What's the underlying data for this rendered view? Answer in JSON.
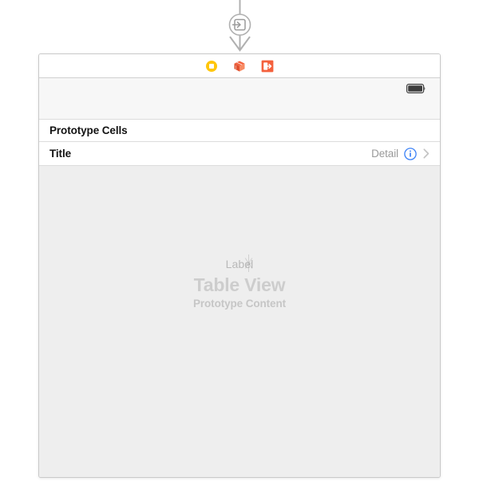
{
  "canvas": {
    "background": "#ffffff",
    "scene_border_color": "#c9c9c9"
  },
  "segue": {
    "name": "relationship-segue-connector",
    "icon": "storyboard-entry-point-icon",
    "line_color": "#b0b0b0",
    "arrow_direction": "down"
  },
  "scene": {
    "dock": {
      "items": [
        {
          "icon": "view-controller-icon",
          "label": "View Controller",
          "color": "#ffc60a"
        },
        {
          "icon": "first-responder-cube-icon",
          "label": "First Responder",
          "color": "#f4613d"
        },
        {
          "icon": "exit-segue-icon",
          "label": "Exit",
          "color": "#f4613d"
        }
      ]
    },
    "status_bar": {
      "battery": {
        "icon": "battery-icon",
        "level": 100,
        "body_color": "#3d3d3d"
      }
    },
    "table_view": {
      "background": "#eeeeee",
      "section_header": "Prototype Cells",
      "cells": [
        {
          "title": "Title",
          "detail": "Detail",
          "accessory": "detail-disclosure-button",
          "accessory_color": "#3c82f7",
          "chevron": "chevron-right-icon"
        }
      ],
      "placeholder": {
        "label": "Label",
        "title": "Table View",
        "subtitle": "Prototype Content",
        "cursor": "text-insertion-cursor"
      }
    }
  }
}
